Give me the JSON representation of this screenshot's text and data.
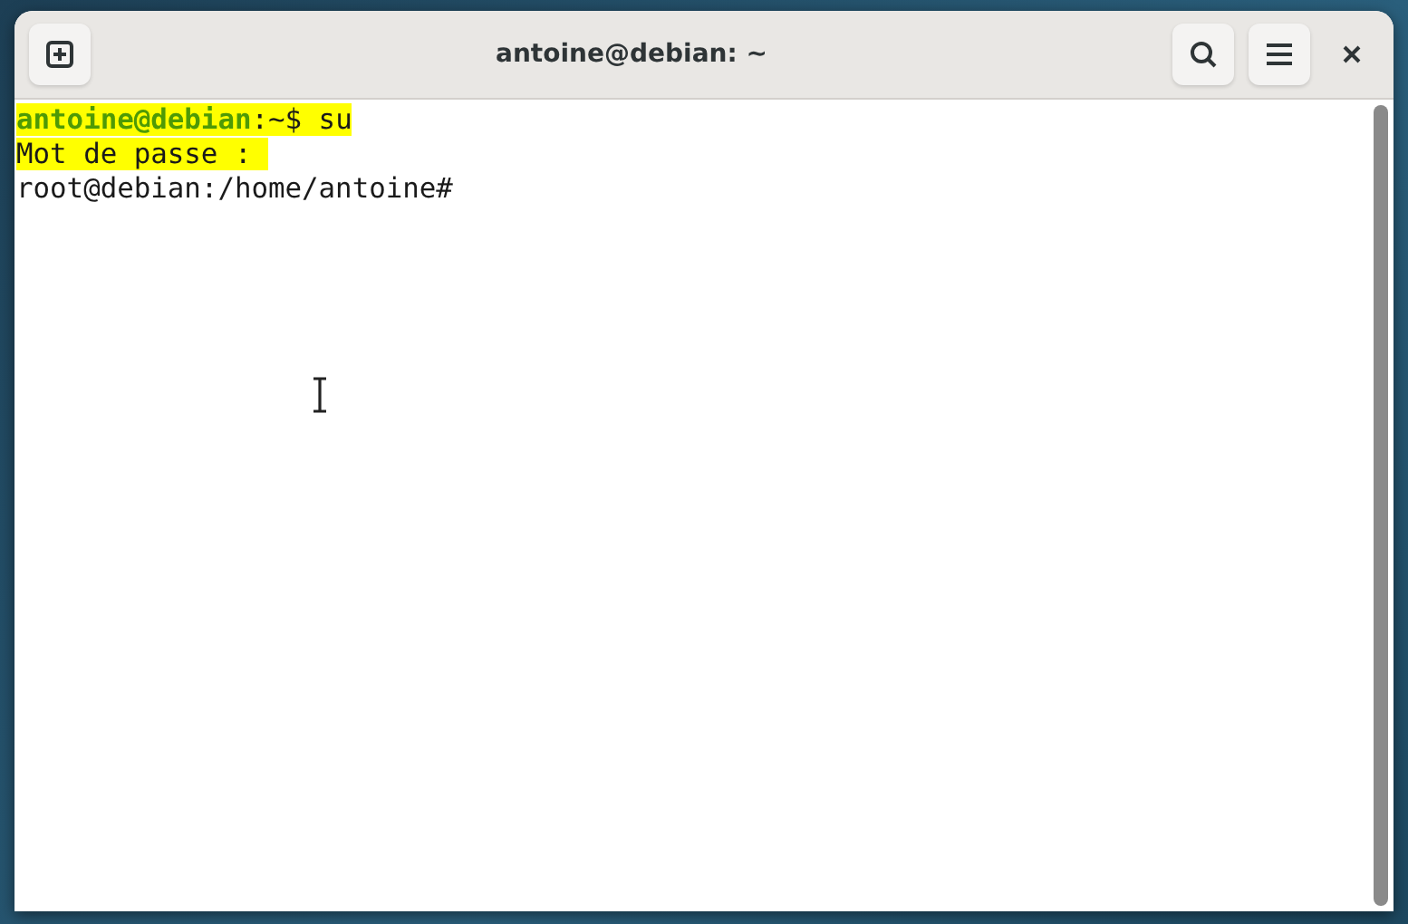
{
  "window": {
    "title": "antoine@debian: ~"
  },
  "terminal": {
    "lines": [
      {
        "highlighted": true,
        "segments": [
          {
            "kind": "prompt",
            "text": "antoine@debian"
          },
          {
            "kind": "plain",
            "text": ":~$ su"
          }
        ]
      },
      {
        "highlighted": true,
        "segments": [
          {
            "kind": "plain",
            "text": "Mot de passe : "
          }
        ]
      },
      {
        "highlighted": false,
        "segments": [
          {
            "kind": "plain",
            "text": "root@debian:/home/antoine#"
          }
        ]
      }
    ]
  }
}
